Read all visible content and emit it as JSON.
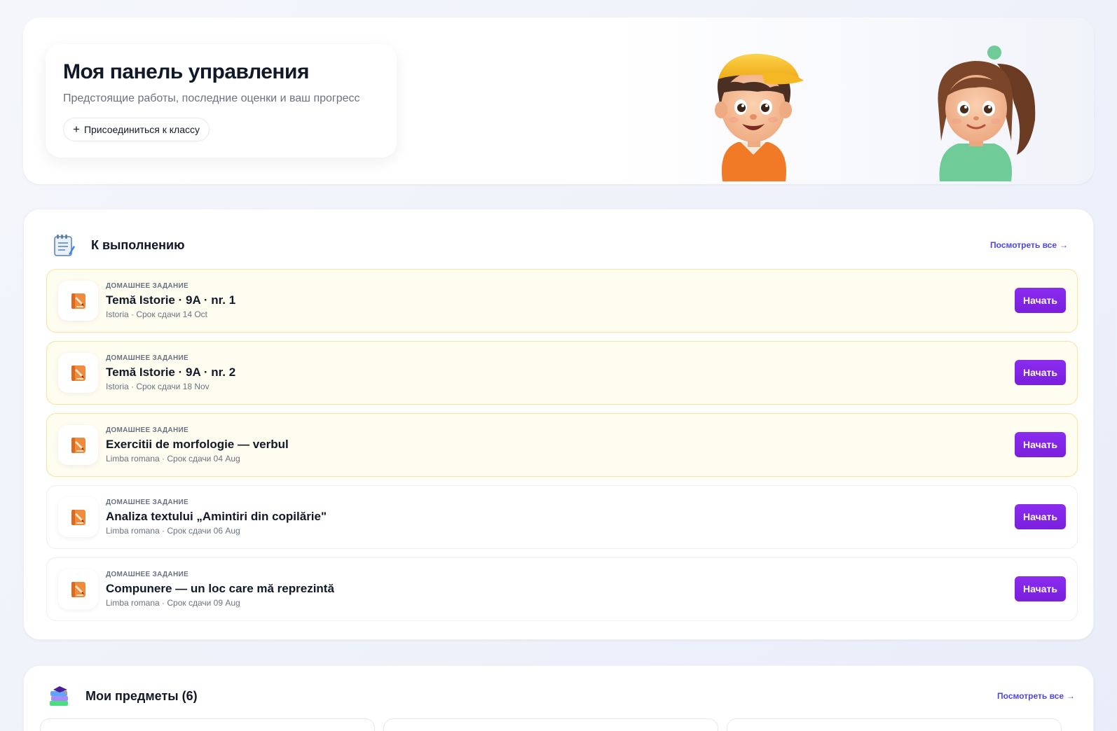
{
  "hero": {
    "title": "Моя панель управления",
    "subtitle": "Предстоящие работы, последние оценки и ваш прогресс",
    "join_label": "Присоединиться к классу",
    "join_icon": "plus-icon"
  },
  "todo": {
    "title": "К выполнению",
    "icon": "notepad-icon",
    "view_all": "Посмотреть все",
    "tasks": [
      {
        "type": "ДОМАШНЕЕ ЗАДАНИЕ",
        "title": "Temă Istorie · 9A · nr. 1",
        "meta": "Istoria · Срок сдачи 14 Oct",
        "action": "Начать",
        "highlighted": true
      },
      {
        "type": "ДОМАШНЕЕ ЗАДАНИЕ",
        "title": "Temă Istorie · 9A · nr. 2",
        "meta": "Istoria · Срок сдачи 18 Nov",
        "action": "Начать",
        "highlighted": true
      },
      {
        "type": "ДОМАШНЕЕ ЗАДАНИЕ",
        "title": "Exercitii de morfologie — verbul",
        "meta": "Limba romana · Срок сдачи 04 Aug",
        "action": "Начать",
        "highlighted": true
      },
      {
        "type": "ДОМАШНЕЕ ЗАДАНИЕ",
        "title": "Analiza textului „Amintiri din copilărie\"",
        "meta": "Limba romana · Срок сдачи 06 Aug",
        "action": "Начать",
        "highlighted": false
      },
      {
        "type": "ДОМАШНЕЕ ЗАДАНИЕ",
        "title": "Compunere — un loc care mă reprezintă",
        "meta": "Limba romana · Срок сдачи 09 Aug",
        "action": "Начать",
        "highlighted": false
      }
    ]
  },
  "subjects": {
    "title": "Мои предметы (6)",
    "icon": "books-icon",
    "view_all": "Посмотреть все"
  },
  "colors": {
    "accent": "#7a1fdc",
    "link": "#4f46e5",
    "highlight_bg": "#fffcf0",
    "highlight_border": "#f7e3a4"
  }
}
